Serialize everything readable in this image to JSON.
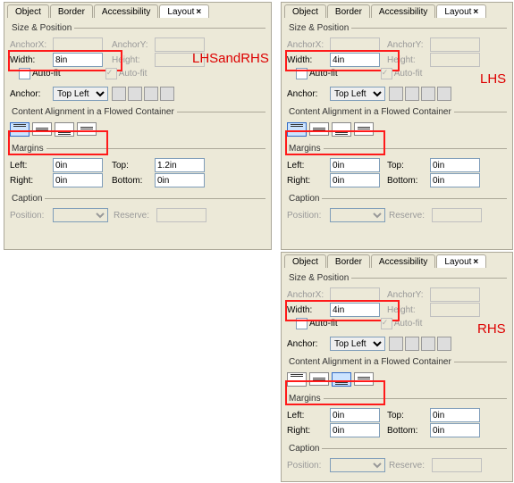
{
  "tabs": {
    "object": "Object",
    "border": "Border",
    "accessibility": "Accessibility",
    "layout": "Layout"
  },
  "sections": {
    "size_pos": "Size & Position",
    "content_align": "Content Alignment in a Flowed Container",
    "margins": "Margins",
    "caption": "Caption"
  },
  "labels": {
    "anchorx": "AnchorX:",
    "anchory": "AnchorY:",
    "width": "Width:",
    "height": "Height:",
    "autofit": "Auto-fit",
    "anchor": "Anchor:",
    "left": "Left:",
    "right": "Right:",
    "top": "Top:",
    "bottom": "Bottom:",
    "position": "Position:",
    "reserve": "Reserve:"
  },
  "panel1": {
    "width": "8in",
    "height": "",
    "anchor": "Top Left",
    "margins": {
      "left": "0in",
      "right": "0in",
      "top": "1.2in",
      "bottom": "0in"
    },
    "align": 0,
    "annotation": "LHSandRHS"
  },
  "panel2": {
    "width": "4in",
    "height": "",
    "anchor": "Top Left",
    "margins": {
      "left": "0in",
      "right": "0in",
      "top": "0in",
      "bottom": "0in"
    },
    "align": 0,
    "annotation": "LHS"
  },
  "panel3": {
    "width": "4in",
    "height": "",
    "anchor": "Top Left",
    "margins": {
      "left": "0in",
      "right": "0in",
      "top": "0in",
      "bottom": "0in"
    },
    "align": 2,
    "annotation": "RHS"
  }
}
